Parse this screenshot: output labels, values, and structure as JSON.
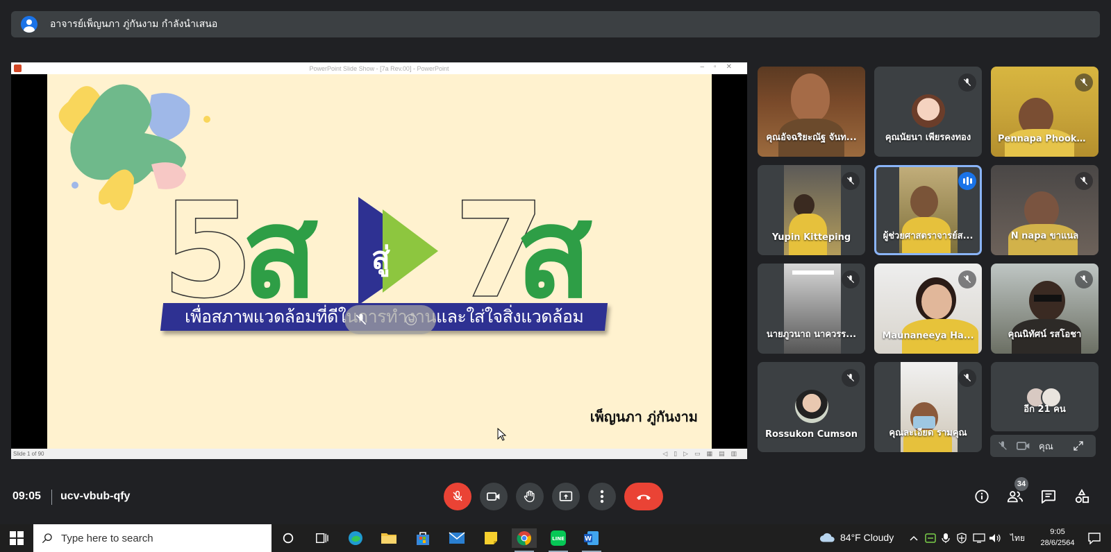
{
  "presenter_banner": {
    "text": "อาจารย์เพ็ญนภา ภู่กันงาม กำลังนำเสนอ"
  },
  "ppt": {
    "window_title": "PowerPoint Slide Show - [7a Rev.00] - PowerPoint",
    "status_left": "Slide 1 of 90"
  },
  "slide": {
    "title_left": "5ส",
    "title_middle": "สู่",
    "title_right": "7ส",
    "subtitle": "เพื่อสภาพแวดล้อมที่ดีในการทำงานและใส่ใจสิ่งแวดล้อม",
    "author": "เพ็ญนภา ภู่กันงาม",
    "colors": {
      "green": "#2e9e46",
      "navy": "#2e3192",
      "light_green": "#8dc63f",
      "background": "#fff2cf"
    }
  },
  "participants": [
    {
      "name": "คุณอัจฉริยะณัฐ จันท...",
      "muted": false
    },
    {
      "name": "คุณนัยนา เพียรคงทอง",
      "muted": true
    },
    {
      "name": "Pennapa Phookan...",
      "muted": true
    },
    {
      "name": "Yupin Kitteping",
      "muted": true
    },
    {
      "name": "ผู้ช่วยศาสตราจารย์ส...",
      "muted": false,
      "speaking": true
    },
    {
      "name": "N napa ขาแนล",
      "muted": true
    },
    {
      "name": "นายภูวนาถ นาควรร...",
      "muted": true
    },
    {
      "name": "Maunaneeya Ha...",
      "muted": true
    },
    {
      "name": "คุณนิทัศน์ รสโอชา",
      "muted": true
    },
    {
      "name": "Rossukon Cumson",
      "muted": true
    },
    {
      "name": "คุณละเอียด รามคุณ",
      "muted": true
    },
    {
      "name": "อีก 21 คน",
      "muted": false
    }
  ],
  "self_view": {
    "label": "คุณ"
  },
  "controls": {
    "time": "09:05",
    "meeting_code": "ucv-vbub-qfy",
    "participant_count": "34",
    "mic_state": "muted"
  },
  "taskbar": {
    "search_placeholder": "Type here to search",
    "weather": "84°F  Cloudy",
    "language": "ไทย",
    "clock_time": "9:05",
    "clock_date": "28/6/2564"
  }
}
